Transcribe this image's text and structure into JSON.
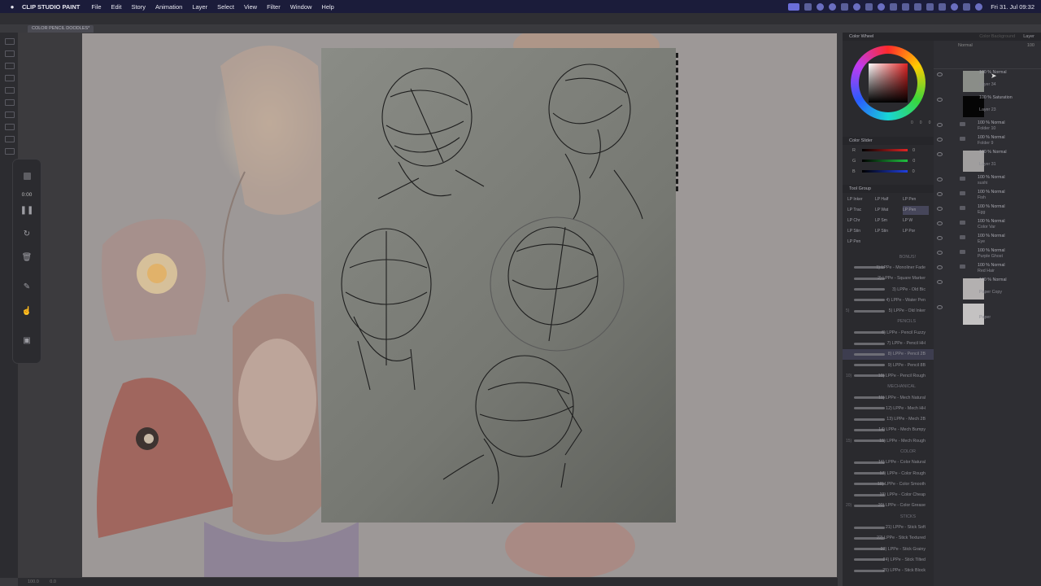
{
  "menubar": {
    "apple": "",
    "app_name": "CLIP STUDIO PAINT",
    "items": [
      "File",
      "Edit",
      "Story",
      "Animation",
      "Layer",
      "Select",
      "View",
      "Filter",
      "Window",
      "Help"
    ],
    "clock": "Fri 31. Jul  09:32"
  },
  "document": {
    "tab_label": "COLOR PENCIL DOODLES*"
  },
  "recorder": {
    "time": "0:00"
  },
  "panels": {
    "color_wheel_title": "Color Wheel",
    "color_slider_title": "Color Slider",
    "slider_labels": [
      "R",
      "G",
      "B"
    ],
    "slider_values": [
      "0",
      "0",
      "0"
    ],
    "wheel_values": [
      "0",
      "0",
      "0"
    ],
    "tool_group_title": "Tool Group",
    "tool_group_items": [
      "LP Inker",
      "LP Half",
      "LP Pen",
      "LP Trac",
      "LP Wat",
      "LP Pen",
      "LP Chr",
      "LP Sm",
      "LP W",
      "LP Stin",
      "LP Stin",
      "LP Por",
      "LP Pen"
    ],
    "tool_group_selected": 5
  },
  "brushes": [
    {
      "label": "BONUS!",
      "section": true
    },
    {
      "label": "1) LPPe - Monoliner Fade"
    },
    {
      "label": "2) LPPe - Square Marker"
    },
    {
      "label": "3) LPPe - Old Bic"
    },
    {
      "label": "4) LPPe - Water Pen"
    },
    {
      "label": "5) LPPe - Old Inker"
    },
    {
      "label": "PENCILS",
      "section": true
    },
    {
      "label": "6) LPPe - Pencil Fuzzy"
    },
    {
      "label": "7) LPPe - Pencil HH"
    },
    {
      "label": "8) LPPe - Pencil 2B",
      "selected": true
    },
    {
      "label": "9) LPPe - Pencil 8B"
    },
    {
      "label": "10) LPPe - Pencil Rough"
    },
    {
      "label": "MECHANICAL",
      "section": true
    },
    {
      "label": "11) LPPe - Mech Natural"
    },
    {
      "label": "12) LPPe - Mech HH"
    },
    {
      "label": "13) LPPe - Mech 2B"
    },
    {
      "label": "14) LPPe - Mech Bumpy"
    },
    {
      "label": "15) LPPe - Mech Rough"
    },
    {
      "label": "COLOR",
      "section": true
    },
    {
      "label": "16) LPPe - Color Natural"
    },
    {
      "label": "17) LPPe - Color Rough"
    },
    {
      "label": "18) LPPe - Color Smooth"
    },
    {
      "label": "19) LPPe - Color Cheap"
    },
    {
      "label": "20) LPPe - Color Grease"
    },
    {
      "label": "STICKS",
      "section": true
    },
    {
      "label": "21) LPPe - Stick Soft"
    },
    {
      "label": "22) LPPe - Stick Textured"
    },
    {
      "label": "23) LPPe - Stick Grainy"
    },
    {
      "label": "24) LPPe - Stick Tilted"
    },
    {
      "label": "25) LPPe - Stick Block"
    }
  ],
  "brush_numbers": [
    "5)",
    "10)",
    "15)",
    "20)"
  ],
  "layers": {
    "tabs": [
      "Color Background",
      "Layer"
    ],
    "blend_mode": "Normal",
    "opacity": "100",
    "rows": [
      {
        "mode": "100 % Normal",
        "name": "Layer 34",
        "thumb": "#8a8d88",
        "tall": true
      },
      {
        "mode": "100 % Saturation",
        "name": "Layer 23",
        "thumb": "#050505",
        "tall": true
      },
      {
        "mode": "100 % Normal",
        "name": "Folder 10",
        "folder": true
      },
      {
        "mode": "100 % Normal",
        "name": "Folder 9",
        "folder": true
      },
      {
        "mode": "100 % Normal",
        "name": "Layer 31",
        "thumb": "#a09e9e",
        "tall": true
      },
      {
        "mode": "100 % Normal",
        "name": "sushi",
        "folder": true
      },
      {
        "mode": "100 % Normal",
        "name": "Fish",
        "folder": true
      },
      {
        "mode": "100 % Normal",
        "name": "Egg",
        "folder": true
      },
      {
        "mode": "100 % Normal",
        "name": "Color Var",
        "folder": true
      },
      {
        "mode": "100 % Normal",
        "name": "Eye",
        "folder": true
      },
      {
        "mode": "100 % Normal",
        "name": "Purple Ghost",
        "folder": true
      },
      {
        "mode": "100 % Normal",
        "name": "Red Hair",
        "folder": true
      },
      {
        "mode": "100 % Normal",
        "name": "Paper Copy",
        "thumb": "#b3b0b0",
        "tall": true
      },
      {
        "mode": "",
        "name": "Paper",
        "thumb": "#c4c2c2",
        "tall": true
      }
    ]
  },
  "statusbar": {
    "zoom": "100.0",
    "angle": "0.0"
  }
}
